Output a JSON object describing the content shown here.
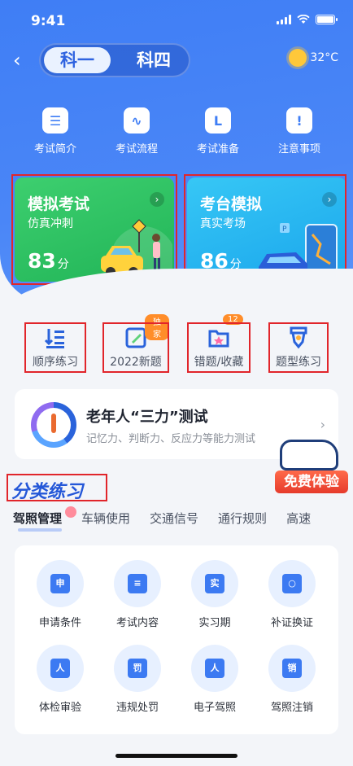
{
  "status": {
    "time": "9:41"
  },
  "header": {
    "segments": [
      "科一",
      "科四"
    ],
    "active_segment": "科一",
    "weather": "32°C"
  },
  "quick_links": [
    {
      "label": "考试简介",
      "icon": "document-icon"
    },
    {
      "label": "考试流程",
      "icon": "flow-icon"
    },
    {
      "label": "考试准备",
      "icon": "prepare-icon"
    },
    {
      "label": "注意事项",
      "icon": "notice-icon"
    }
  ],
  "cards": [
    {
      "title": "模拟考试",
      "subtitle": "仿真冲刺",
      "score": "83",
      "unit": "分",
      "color": "#21b457"
    },
    {
      "title": "考台模拟",
      "subtitle": "真实考场",
      "score": "86",
      "unit": "分",
      "color": "#1aa6ec"
    }
  ],
  "practice": [
    {
      "label": "顺序练习"
    },
    {
      "label": "2022新题",
      "badge": "独家"
    },
    {
      "label": "错题/收藏",
      "badge": "12"
    },
    {
      "label": "题型练习"
    }
  ],
  "elder": {
    "title": "老年人“三力”测试",
    "subtitle": "记忆力、判断力、反应力等能力测试"
  },
  "promo": {
    "label": "免费体验"
  },
  "section": {
    "title": "分类练习",
    "tabs": [
      "驾照管理",
      "车辆使用",
      "交通信号",
      "通行规则",
      "高速"
    ],
    "active_tab": "驾照管理"
  },
  "categories": [
    {
      "label": "申请条件",
      "glyph": "申"
    },
    {
      "label": "考试内容",
      "glyph": "≡"
    },
    {
      "label": "实习期",
      "glyph": "实"
    },
    {
      "label": "补证换证",
      "glyph": "○"
    },
    {
      "label": "体检审验",
      "glyph": "人"
    },
    {
      "label": "违规处罚",
      "glyph": "罚"
    },
    {
      "label": "电子驾照",
      "glyph": "人"
    },
    {
      "label": "驾照注销",
      "glyph": "销"
    }
  ],
  "colors": {
    "primary": "#3f7ef5",
    "accent_red": "#e1252b"
  }
}
